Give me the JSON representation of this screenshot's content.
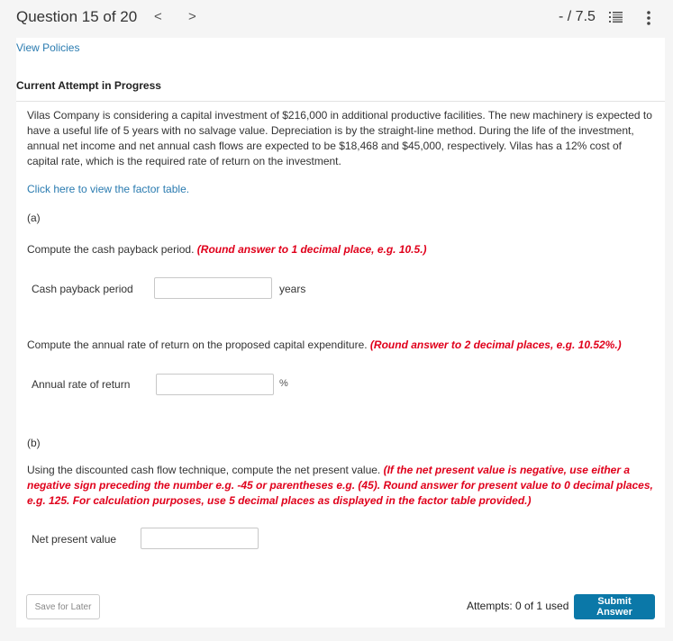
{
  "header": {
    "question_title": "Question 15 of 20",
    "prev_label": "<",
    "next_label": ">",
    "score": "- / 7.5",
    "list_icon": "numbered-list-icon",
    "more_icon": "more-vertical-icon"
  },
  "view_policies": "View Policies",
  "attempt_heading": "Current Attempt in Progress",
  "problem_text": "Vilas Company is considering a capital investment of $216,000 in additional productive facilities. The new machinery is expected to have a useful life of 5 years with no salvage value. Depreciation is by the straight-line method. During the life of the investment, annual net income and net annual cash flows are expected to be $18,468 and $45,000, respectively. Vilas has a 12% cost of capital rate, which is the required rate of return on the investment.",
  "factor_table_link": "Click here to view the factor table.",
  "part_a": {
    "label": "(a)",
    "q1_text": "Compute the cash payback period. ",
    "q1_instruction": "(Round answer to 1 decimal place, e.g. 10.5.)",
    "q1_field_label": "Cash payback period",
    "q1_value": "",
    "q1_unit": "years",
    "q2_text": "Compute the annual rate of return on the proposed capital expenditure. ",
    "q2_instruction": "(Round answer to 2 decimal places, e.g. 10.52%.)",
    "q2_field_label": "Annual rate of return",
    "q2_value": "",
    "q2_unit": "%"
  },
  "part_b": {
    "label": "(b)",
    "q_text": "Using the discounted cash flow technique, compute the net present value. ",
    "q_instruction": "(If the net present value is negative, use either a negative sign preceding the number e.g. -45 or parentheses e.g. (45). Round answer for present value to 0 decimal places, e.g. 125. For calculation purposes, use 5 decimal places as displayed in the factor table provided.)",
    "field_label": "Net present value",
    "value": ""
  },
  "footer": {
    "save_label": "Save for Later",
    "attempts_text": "Attempts: 0 of 1 used",
    "submit_label": "Submit Answer"
  },
  "colors": {
    "link": "#2a7bb0",
    "instruction_red": "#e0001b",
    "submit_bg": "#0b78a8",
    "page_bg": "#f5f5f5"
  }
}
